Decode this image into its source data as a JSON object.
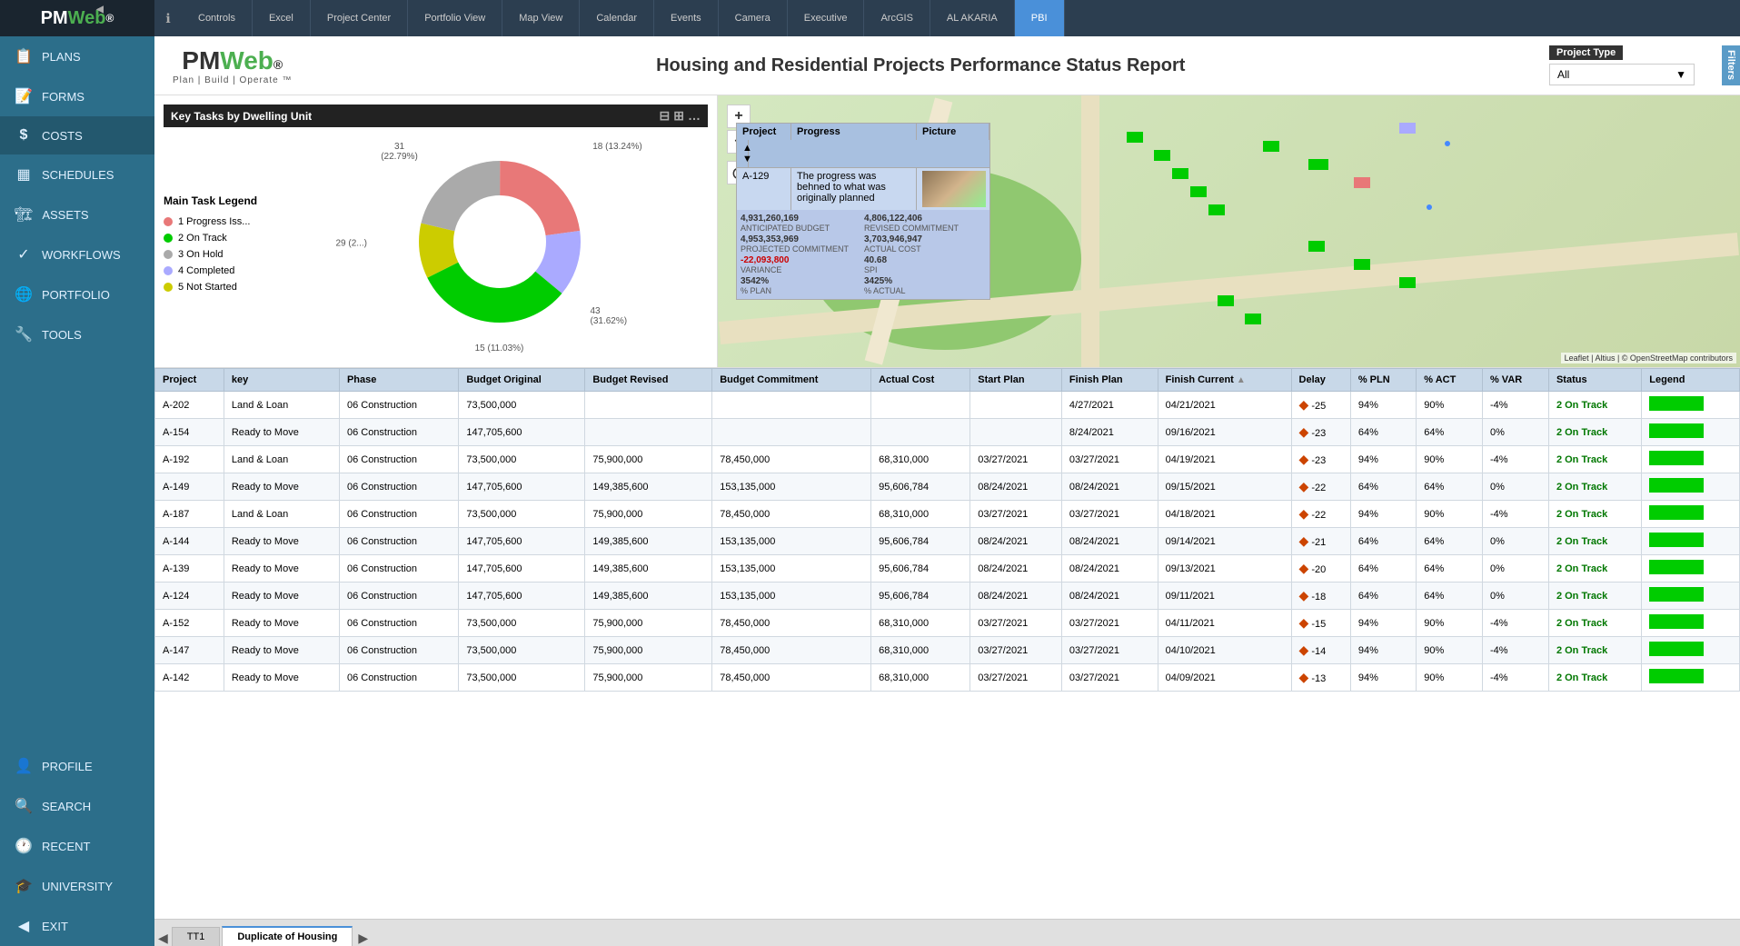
{
  "app": {
    "logo_pm": "PM",
    "logo_web": "Web",
    "logo_symbol": "®",
    "info_icon": "ℹ"
  },
  "top_nav": {
    "tabs": [
      {
        "label": "Controls",
        "active": false
      },
      {
        "label": "Excel",
        "active": false
      },
      {
        "label": "Project Center",
        "active": false
      },
      {
        "label": "Portfolio View",
        "active": false
      },
      {
        "label": "Map View",
        "active": false
      },
      {
        "label": "Calendar",
        "active": false
      },
      {
        "label": "Events",
        "active": false
      },
      {
        "label": "Camera",
        "active": false
      },
      {
        "label": "Executive",
        "active": false
      },
      {
        "label": "ArcGIS",
        "active": false
      },
      {
        "label": "AL AKARIA",
        "active": false
      },
      {
        "label": "PBI",
        "active": true
      }
    ]
  },
  "sidebar": {
    "items": [
      {
        "label": "PLANS",
        "icon": "📋"
      },
      {
        "label": "FORMS",
        "icon": "📝"
      },
      {
        "label": "COSTS",
        "icon": "$",
        "active": true
      },
      {
        "label": "SCHEDULES",
        "icon": "📅"
      },
      {
        "label": "ASSETS",
        "icon": "🏗"
      },
      {
        "label": "WORKFLOWS",
        "icon": "✓"
      },
      {
        "label": "PORTFOLIO",
        "icon": "🌐"
      },
      {
        "label": "TOOLS",
        "icon": "🔧"
      },
      {
        "label": "PROFILE",
        "icon": "👤"
      },
      {
        "label": "SEARCH",
        "icon": "🔍"
      },
      {
        "label": "RECENT",
        "icon": "🕐"
      },
      {
        "label": "UNIVERSITY",
        "icon": "🎓"
      },
      {
        "label": "EXIT",
        "icon": "⬅"
      }
    ]
  },
  "header": {
    "brand_pm": "PM",
    "brand_web": "Web",
    "brand_symbol": "®",
    "brand_subtitle": "Plan | Build | Operate ™",
    "report_title": "Housing and Residential Projects Performance Status Report",
    "project_type_label": "Project Type",
    "project_type_value": "All",
    "filters_label": "Filters"
  },
  "chart": {
    "title": "Key Tasks by Dwelling Unit",
    "legend_title": "Main Task Legend",
    "legend_items": [
      {
        "label": "1 Progress Iss...",
        "color": "#e87878"
      },
      {
        "label": "2 On Track",
        "color": "#00cc00"
      },
      {
        "label": "3 On Hold",
        "color": "#aaaaaa"
      },
      {
        "label": "4 Completed",
        "color": "#aaaaff"
      },
      {
        "label": "5 Not Started",
        "color": "#ffee44"
      }
    ],
    "donut_segments": [
      {
        "label": "31 (22.79%)",
        "color": "#e87878",
        "value": 22.79,
        "pos": "top-left"
      },
      {
        "label": "18 (13.24%)",
        "color": "#aaaaff",
        "value": 13.24,
        "pos": "top-right"
      },
      {
        "label": "43 (31.62%)",
        "color": "#00cc00",
        "value": 31.62,
        "pos": "right"
      },
      {
        "label": "15 (11.03%)",
        "color": "#ffee44",
        "value": 11.03,
        "pos": "bottom"
      },
      {
        "label": "29 (2...)",
        "color": "#aaaaaa",
        "value": 21.32,
        "pos": "left"
      }
    ]
  },
  "map": {
    "zoom_in": "+",
    "zoom_out": "−",
    "attribution": "Leaflet | Altius | © OpenStreetMap contributors",
    "popup": {
      "col_project": "Project",
      "col_progress": "Progress",
      "col_picture": "Picture",
      "row_id": "A-129",
      "row_progress": "The progress was behned to what was originally planned",
      "anticipated_budget_value": "4,931,260,169",
      "anticipated_budget_label": "ANTICIPATED BUDGET",
      "revised_commitment_value": "4,806,122,406",
      "revised_commitment_label": "REVISED COMMITMENT",
      "projected_commitment_value": "4,953,353,969",
      "projected_commitment_label": "PROJECTED COMMITMENT",
      "actual_cost_value": "3,703,946,947",
      "actual_cost_label": "ACTUAL COST",
      "variance_value": "-22,093,800",
      "variance_label": "VARIANCE",
      "spi_value": "40.68",
      "spi_label": "SPI",
      "pct_plan_value": "3542%",
      "pct_plan_label": "% Plan",
      "pct_actual_value": "3425%",
      "pct_actual_label": "% Actual"
    }
  },
  "table": {
    "columns": [
      "Project",
      "key",
      "Phase",
      "Budget Original",
      "Budget Revised",
      "Budget Commitment",
      "Actual Cost",
      "Start Plan",
      "Finish Plan",
      "Finish Current",
      "Delay",
      "% PLN",
      "% ACT",
      "% VAR",
      "Status",
      "Legend"
    ],
    "rows": [
      {
        "project": "A-202",
        "key": "Land & Loan",
        "phase": "06 Construction",
        "budget_original": "73,500,000",
        "budget_revised": "",
        "budget_commitment": "",
        "actual_cost": "",
        "start_plan": "",
        "finish_plan": "4/27/2021",
        "finish_current": "04/21/2021",
        "delay": "-25",
        "pln": "94%",
        "act": "90%",
        "var": "-4%",
        "status": "2 On Track"
      },
      {
        "project": "A-154",
        "key": "Ready to Move",
        "phase": "06 Construction",
        "budget_original": "147,705,600",
        "budget_revised": "",
        "budget_commitment": "",
        "actual_cost": "",
        "start_plan": "",
        "finish_plan": "8/24/2021",
        "finish_current": "09/16/2021",
        "delay": "-23",
        "pln": "64%",
        "act": "64%",
        "var": "0%",
        "status": "2 On Track"
      },
      {
        "project": "A-192",
        "key": "Land & Loan",
        "phase": "06 Construction",
        "budget_original": "73,500,000",
        "budget_revised": "75,900,000",
        "budget_commitment": "78,450,000",
        "actual_cost": "68,310,000",
        "start_plan": "03/27/2021",
        "finish_plan": "03/27/2021",
        "finish_current": "04/19/2021",
        "delay": "-23",
        "pln": "94%",
        "act": "90%",
        "var": "-4%",
        "status": "2 On Track"
      },
      {
        "project": "A-149",
        "key": "Ready to Move",
        "phase": "06 Construction",
        "budget_original": "147,705,600",
        "budget_revised": "149,385,600",
        "budget_commitment": "153,135,000",
        "actual_cost": "95,606,784",
        "start_plan": "08/24/2021",
        "finish_plan": "08/24/2021",
        "finish_current": "09/15/2021",
        "delay": "-22",
        "pln": "64%",
        "act": "64%",
        "var": "0%",
        "status": "2 On Track"
      },
      {
        "project": "A-187",
        "key": "Land & Loan",
        "phase": "06 Construction",
        "budget_original": "73,500,000",
        "budget_revised": "75,900,000",
        "budget_commitment": "78,450,000",
        "actual_cost": "68,310,000",
        "start_plan": "03/27/2021",
        "finish_plan": "03/27/2021",
        "finish_current": "04/18/2021",
        "delay": "-22",
        "pln": "94%",
        "act": "90%",
        "var": "-4%",
        "status": "2 On Track"
      },
      {
        "project": "A-144",
        "key": "Ready to Move",
        "phase": "06 Construction",
        "budget_original": "147,705,600",
        "budget_revised": "149,385,600",
        "budget_commitment": "153,135,000",
        "actual_cost": "95,606,784",
        "start_plan": "08/24/2021",
        "finish_plan": "08/24/2021",
        "finish_current": "09/14/2021",
        "delay": "-21",
        "pln": "64%",
        "act": "64%",
        "var": "0%",
        "status": "2 On Track"
      },
      {
        "project": "A-139",
        "key": "Ready to Move",
        "phase": "06 Construction",
        "budget_original": "147,705,600",
        "budget_revised": "149,385,600",
        "budget_commitment": "153,135,000",
        "actual_cost": "95,606,784",
        "start_plan": "08/24/2021",
        "finish_plan": "08/24/2021",
        "finish_current": "09/13/2021",
        "delay": "-20",
        "pln": "64%",
        "act": "64%",
        "var": "0%",
        "status": "2 On Track"
      },
      {
        "project": "A-124",
        "key": "Ready to Move",
        "phase": "06 Construction",
        "budget_original": "147,705,600",
        "budget_revised": "149,385,600",
        "budget_commitment": "153,135,000",
        "actual_cost": "95,606,784",
        "start_plan": "08/24/2021",
        "finish_plan": "08/24/2021",
        "finish_current": "09/11/2021",
        "delay": "-18",
        "pln": "64%",
        "act": "64%",
        "var": "0%",
        "status": "2 On Track"
      },
      {
        "project": "A-152",
        "key": "Ready to Move",
        "phase": "06 Construction",
        "budget_original": "73,500,000",
        "budget_revised": "75,900,000",
        "budget_commitment": "78,450,000",
        "actual_cost": "68,310,000",
        "start_plan": "03/27/2021",
        "finish_plan": "03/27/2021",
        "finish_current": "04/11/2021",
        "delay": "-15",
        "pln": "94%",
        "act": "90%",
        "var": "-4%",
        "status": "2 On Track"
      },
      {
        "project": "A-147",
        "key": "Ready to Move",
        "phase": "06 Construction",
        "budget_original": "73,500,000",
        "budget_revised": "75,900,000",
        "budget_commitment": "78,450,000",
        "actual_cost": "68,310,000",
        "start_plan": "03/27/2021",
        "finish_plan": "03/27/2021",
        "finish_current": "04/10/2021",
        "delay": "-14",
        "pln": "94%",
        "act": "90%",
        "var": "-4%",
        "status": "2 On Track"
      },
      {
        "project": "A-142",
        "key": "Ready to Move",
        "phase": "06 Construction",
        "budget_original": "73,500,000",
        "budget_revised": "75,900,000",
        "budget_commitment": "78,450,000",
        "actual_cost": "68,310,000",
        "start_plan": "03/27/2021",
        "finish_plan": "03/27/2021",
        "finish_current": "04/09/2021",
        "delay": "-13",
        "pln": "94%",
        "act": "90%",
        "var": "-4%",
        "status": "2 On Track"
      }
    ]
  },
  "bottom_tabs": [
    {
      "label": "TT1",
      "active": false
    },
    {
      "label": "Duplicate of Housing",
      "active": true
    }
  ]
}
